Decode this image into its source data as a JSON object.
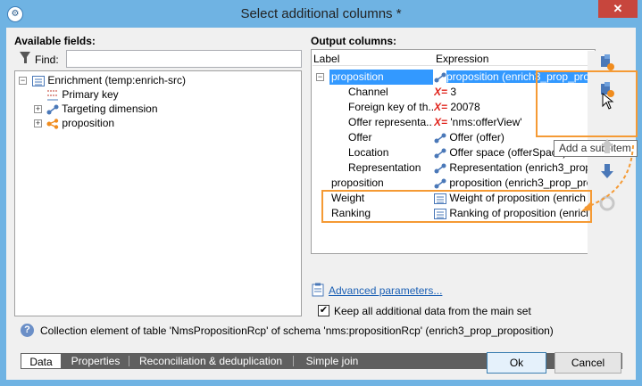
{
  "window": {
    "title": "Select additional columns *",
    "close": "✕"
  },
  "available": {
    "label": "Available fields:",
    "find_label": "Find:",
    "find_value": "",
    "tree": [
      {
        "label": "Enrichment  (temp:enrich-src)",
        "icon": "list-icon"
      },
      {
        "label": "Primary key",
        "icon": "key-icon"
      },
      {
        "label": "Targeting dimension",
        "icon": "link-icon"
      },
      {
        "label": "proposition",
        "icon": "share-icon"
      }
    ]
  },
  "output": {
    "label": "Output columns:",
    "col_label": "Label",
    "col_expression": "Expression",
    "rows": [
      {
        "label": "proposition",
        "expr": "proposition (enrich3_prop_pro",
        "icon": "link-icon"
      },
      {
        "label": "Channel",
        "expr": "3",
        "icon": "x-equals-icon",
        "xeq": "X="
      },
      {
        "label": "Foreign key of th...",
        "expr": "20078",
        "icon": "x-equals-icon",
        "xeq": "X="
      },
      {
        "label": "Offer representa...",
        "expr": "'nms:offerView'",
        "icon": "x-equals-icon",
        "xeq": "X="
      },
      {
        "label": "Offer",
        "expr": "Offer (offer)",
        "icon": "link-icon"
      },
      {
        "label": "Location",
        "expr": "Offer space (offerSpace)",
        "icon": "link-icon"
      },
      {
        "label": "Representation",
        "expr": "Representation (enrich3_prop",
        "icon": "link-icon"
      },
      {
        "label": "proposition",
        "expr": "proposition (enrich3_prop_pro",
        "icon": "link-icon"
      },
      {
        "label": "Weight",
        "expr": "Weight of proposition (enrich",
        "icon": "list-icon"
      },
      {
        "label": "Ranking",
        "expr": "Ranking of proposition (enrich",
        "icon": "list-icon"
      }
    ]
  },
  "tooltip": "Add a sub-item",
  "advanced_link": "Advanced parameters...",
  "keep_checkbox": {
    "label": "Keep all additional data from the main set",
    "checked": true
  },
  "info_text": "Collection element of table 'NmsPropositionRcp' of schema 'nms:propositionRcp' (enrich3_prop_proposition)",
  "tabs": [
    "Data",
    "Properties",
    "Reconciliation & deduplication",
    "Simple join"
  ],
  "buttons": {
    "ok": "Ok",
    "cancel": "Cancel"
  },
  "colors": {
    "titlebar": "#6fb3e3",
    "selection": "#3399ff",
    "callout": "#f59a34"
  }
}
